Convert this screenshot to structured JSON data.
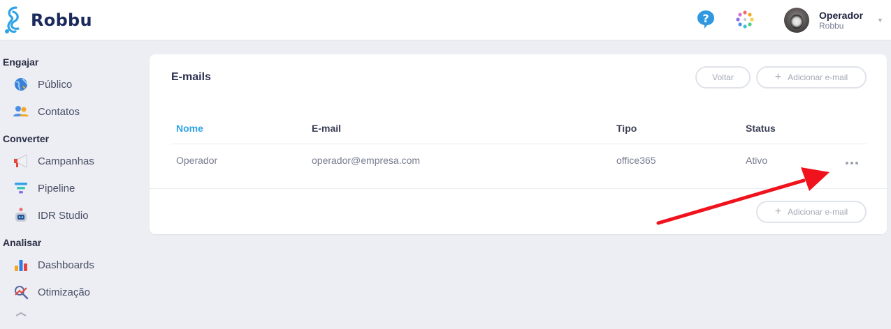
{
  "header": {
    "brand": "Robbu",
    "user": {
      "name": "Operador",
      "organization": "Robbu"
    }
  },
  "sidebar": {
    "sections": [
      {
        "title": "Engajar",
        "items": [
          {
            "label": "Público",
            "icon": "globe-icon"
          },
          {
            "label": "Contatos",
            "icon": "contacts-icon"
          }
        ]
      },
      {
        "title": "Converter",
        "items": [
          {
            "label": "Campanhas",
            "icon": "megaphone-icon"
          },
          {
            "label": "Pipeline",
            "icon": "funnel-icon"
          },
          {
            "label": "IDR Studio",
            "icon": "robot-icon"
          }
        ]
      },
      {
        "title": "Analisar",
        "items": [
          {
            "label": "Dashboards",
            "icon": "bar-chart-icon"
          },
          {
            "label": "Otimização",
            "icon": "optimization-icon"
          }
        ]
      }
    ]
  },
  "main": {
    "title": "E-mails",
    "back_button": "Voltar",
    "add_button": "Adicionar e-mail",
    "table": {
      "columns": [
        "Nome",
        "E-mail",
        "Tipo",
        "Status"
      ],
      "rows": [
        {
          "name": "Operador",
          "email": "operador@empresa.com",
          "type": "office365",
          "status": "Ativo"
        }
      ]
    },
    "footer_add_button": "Adicionar e-mail"
  },
  "colors": {
    "brand": "#1b2a5c",
    "accent": "#2fa3e6",
    "annotation_arrow": "#f0121c"
  }
}
